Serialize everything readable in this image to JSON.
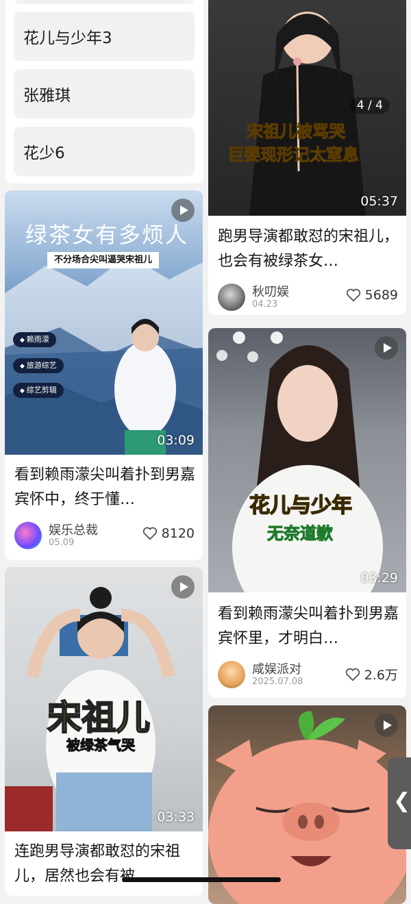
{
  "suggestions": [
    "花儿与少年3",
    "张雅琪",
    "花少6"
  ],
  "cards": {
    "c1": {
      "title": "看到赖雨濛尖叫着扑到男嘉宾怀中，终于懂…",
      "author": "娱乐总裁",
      "date": "05.09",
      "likes": "8120",
      "duration": "03:09",
      "overlay_headline": "绿茶女有多烦人",
      "overlay_banner": "不分场合尖叫逼哭宋祖儿",
      "overlay_tags": [
        "赖雨濛",
        "旅游综艺",
        "综艺剪辑"
      ]
    },
    "c2": {
      "title": "连跑男导演都敢怼的宋祖儿，居然也会有被…",
      "duration": "03:33",
      "overlay_name": "宋祖儿",
      "overlay_sub": "被绿茶气哭"
    },
    "c3": {
      "title": "跑男导演都敢怼的宋祖儿，也会有被绿茶女…",
      "author": "秋叨娱",
      "date": "04.23",
      "likes": "5689",
      "duration": "05:37",
      "counter": "4 / 4",
      "overlay_line1": "宋祖儿被骂哭",
      "overlay_line2": "巨婴现形记太窒息"
    },
    "c4": {
      "title": "看到赖雨濛尖叫着扑到男嘉宾怀里，才明白…",
      "author": "咸娱派对",
      "date": "2025.07.08",
      "likes": "2.6万",
      "duration": "03:29",
      "overlay_line1": "花儿与少年",
      "overlay_line2": "无奈道歉"
    },
    "c5": {}
  },
  "side_handle_glyph": "❮",
  "colors": {
    "page_bg": "#f2f2f2",
    "card_bg": "#ffffff",
    "overlay_yellow": "#ffd21e",
    "overlay_green": "#3fb24a"
  }
}
